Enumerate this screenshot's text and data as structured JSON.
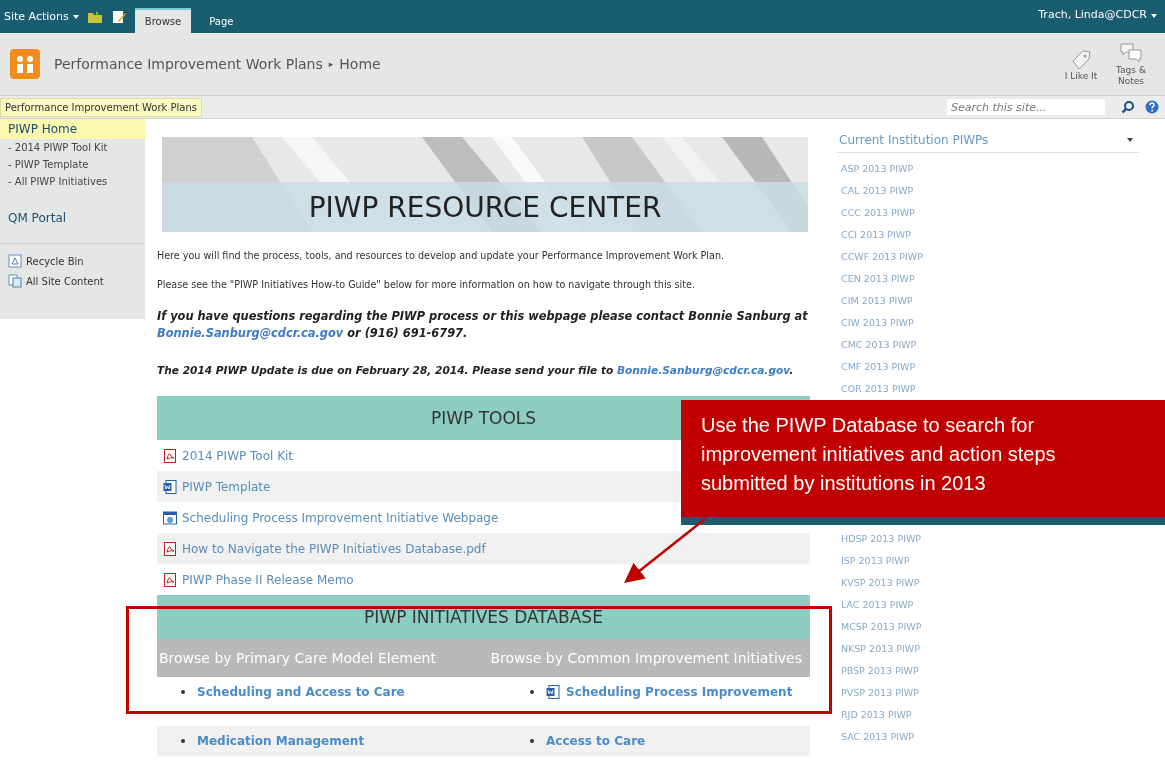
{
  "top_bar": {
    "site_actions": "Site Actions",
    "tabs": [
      {
        "label": "Browse",
        "selected": true
      },
      {
        "label": "Page",
        "selected": false
      }
    ],
    "user": "Trach, Linda@CDCR"
  },
  "header": {
    "site_title": "Performance Improvement Work Plans",
    "separator": "▸",
    "page": "Home",
    "actions": [
      {
        "kind": "like",
        "label": "I Like It"
      },
      {
        "kind": "tags",
        "label": "Tags & Notes"
      }
    ]
  },
  "nav_bar": {
    "breadcrumb": "Performance Improvement Work Plans",
    "search_placeholder": "Search this site..."
  },
  "sidebar": {
    "items": [
      {
        "kind": "heading",
        "label": "PIWP Home",
        "selected": true
      },
      {
        "kind": "sub",
        "label": "- 2014 PIWP Tool Kit",
        "selected": false
      },
      {
        "kind": "sub",
        "label": "- PIWP Template",
        "selected": false
      },
      {
        "kind": "sub",
        "label": "- All PIWP Initiatives",
        "selected": false
      },
      {
        "kind": "heading",
        "label": "QM Portal",
        "selected": false
      }
    ],
    "footer": [
      {
        "kind": "recycle",
        "label": "Recycle Bin"
      },
      {
        "kind": "content",
        "label": "All Site Content"
      }
    ]
  },
  "main": {
    "banner_title": "PIWP RESOURCE CENTER",
    "intro": [
      "Here you will find the process, tools, and resources to develop and update your Performance Improvement Work Plan.",
      "Please see the \"PIWP Initiatives How-to Guide\" below for more information on how to navigate through this site."
    ],
    "contact": {
      "before": "If you have questions regarding the PIWP process or this webpage please contact Bonnie Sanburg at",
      "link": "Bonnie.Sanburg@cdcr.ca.gov",
      "after": "or (916) 691-6797."
    },
    "due": {
      "before": "The 2014 PIWP Update is due on February 28, 2014.  Please send your file to",
      "link": "Bonnie.Sanburg@cdcr.ca.gov",
      "after": "."
    },
    "tools": {
      "title": "PIWP TOOLS",
      "items": [
        {
          "kind": "pdf",
          "label": "2014 PIWP Tool Kit"
        },
        {
          "kind": "word",
          "label": "PIWP Template"
        },
        {
          "kind": "web",
          "label": "Scheduling Process Improvement Initiative Webpage"
        },
        {
          "kind": "pdf",
          "label": "How to Navigate the PIWP Initiatives Database.pdf"
        },
        {
          "kind": "pdf",
          "label": "PIWP Phase II Release Memo"
        }
      ]
    },
    "database": {
      "title": "PIWP INITIATIVES DATABASE",
      "columns": [
        "Browse by Primary Care Model Element",
        "Browse by Common Improvement Initiatives"
      ],
      "rows": [
        [
          {
            "kind": "link",
            "label": "Scheduling and Access to Care"
          },
          {
            "kind": "word",
            "label": "Scheduling Process Improvement"
          }
        ],
        [
          {
            "kind": "link",
            "label": "Medication Management"
          },
          {
            "kind": "link",
            "label": "Access to Care"
          }
        ]
      ]
    }
  },
  "right_panel": {
    "title": "Current Institution PIWPs",
    "items_top": [
      "ASP 2013 PIWP",
      "CAL 2013 PIWP",
      "CCC 2013 PIWP",
      "CCI 2013 PIWP",
      "CCWF 2013 PIWP",
      "CEN 2013 PIWP",
      "CIM 2013 PIWP",
      "CIW 2013 PIWP",
      "CMC 2013 PIWP",
      "CMF 2013 PIWP",
      "COR 2013 PIWP"
    ],
    "items_bottom": [
      "HDSP 2013 PIWP",
      "ISP 2013 PIWP",
      "KVSP 2013 PIWP",
      "LAC 2013 PIWP",
      "MCSP 2013 PIWP",
      "NKSP 2013 PIWP",
      "PBSP 2013 PIWP",
      "PVSP 2013 PIWP",
      "RJD 2013 PIWP",
      "SAC 2013 PIWP"
    ]
  },
  "callout": {
    "text": "Use the PIWP Database to search for improvement initiatives and action steps submitted by institutions in 2013"
  }
}
